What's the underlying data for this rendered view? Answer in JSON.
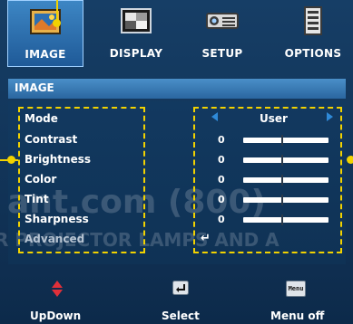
{
  "tabs": [
    {
      "label": "IMAGE",
      "icon": "image-icon",
      "active": true
    },
    {
      "label": "DISPLAY",
      "icon": "display-icon",
      "active": false
    },
    {
      "label": "SETUP",
      "icon": "setup-icon",
      "active": false
    },
    {
      "label": "OPTIONS",
      "icon": "options-icon",
      "active": false
    }
  ],
  "section_title": "IMAGE",
  "menu": {
    "items": [
      {
        "label": "Mode",
        "value": "User"
      },
      {
        "label": "Contrast",
        "value": "0",
        "level": 0.45
      },
      {
        "label": "Brightness",
        "value": "0",
        "level": 0.45
      },
      {
        "label": "Color",
        "value": "0",
        "level": 0.45
      },
      {
        "label": "Tint",
        "value": "0",
        "level": 0.45
      },
      {
        "label": "Sharpness",
        "value": "0",
        "level": 0.45
      },
      {
        "label": "Advanced",
        "value": "↵"
      }
    ]
  },
  "watermark": {
    "line1": "ant.com (800)",
    "line2": "R PROJECTOR LAMPS AND A"
  },
  "bottom": {
    "updown": "UpDown",
    "select": "Select",
    "menu_icon_text": "Menu",
    "menu_off": "Menu off"
  },
  "colors": {
    "accent_yellow": "#f2d200",
    "active_tab": "#2f6fae",
    "arrow_blue": "#2f8ad8",
    "background": "#0f2e50"
  }
}
